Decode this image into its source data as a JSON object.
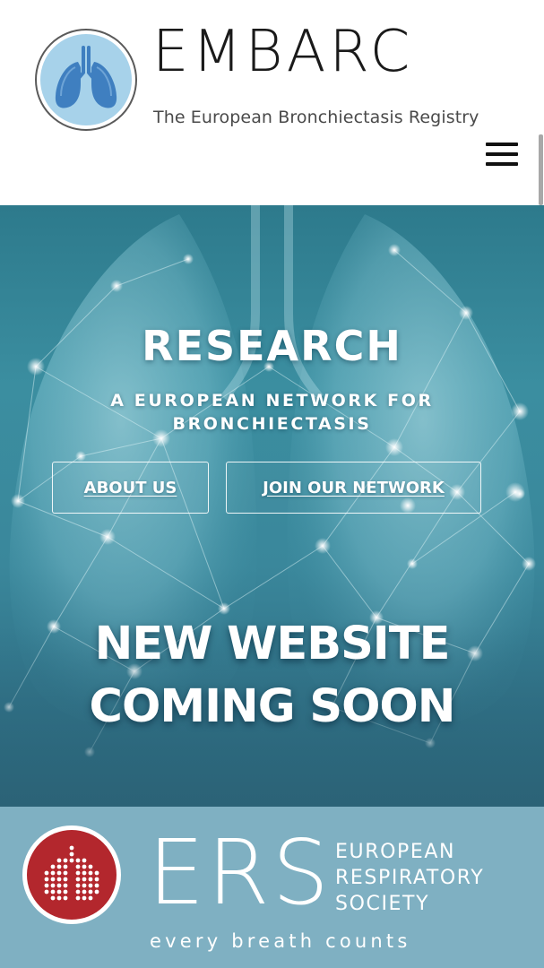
{
  "header": {
    "brand_name": "EMBARC",
    "tagline": "The European Bronchiectasis Registry",
    "menu_icon": "hamburger-menu-icon",
    "colors": {
      "logo_ring": "#5a5a5a",
      "logo_fill": "#9fcde6",
      "lung_fill": "#3f7fc0"
    }
  },
  "hero": {
    "title": "RESEARCH",
    "subtitle_line1": "A EUROPEAN NETWORK FOR",
    "subtitle_line2": "BRONCHIECTASIS",
    "buttons": {
      "about_label": "ABOUT US",
      "join_label": "JOIN OUR NETWORK"
    },
    "announcement_line1": "NEW WEBSITE",
    "announcement_line2": "COMING SOON",
    "colors": {
      "background": "#3a879b",
      "glow": "#cdeff5"
    }
  },
  "footer": {
    "logo_letters": "ERS",
    "org_line1": "EUROPEAN",
    "org_line2": "RESPIRATORY",
    "org_line3": "SOCIETY",
    "slogan": "every breath counts",
    "colors": {
      "background": "#7fb0c2",
      "logo_red": "#b3272d"
    }
  }
}
